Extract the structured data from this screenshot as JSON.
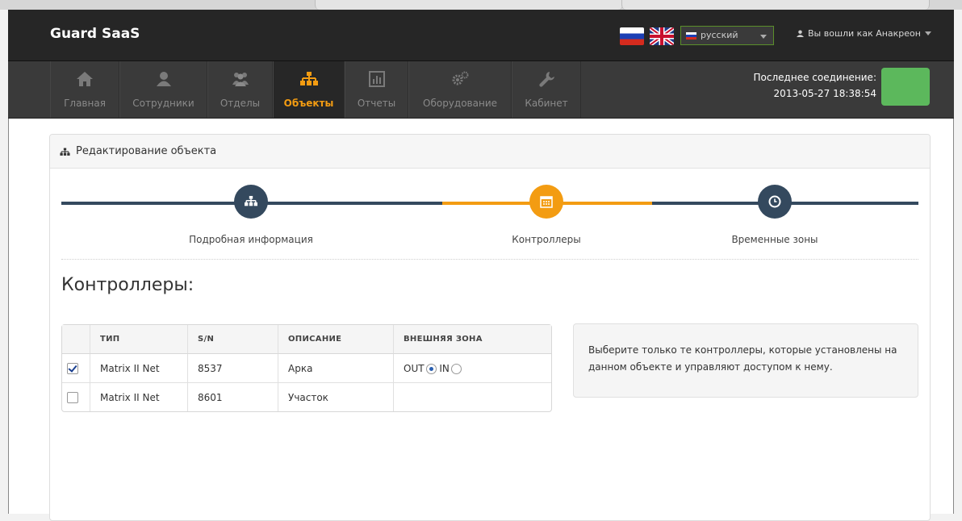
{
  "app": {
    "brand": "Guard SaaS"
  },
  "header": {
    "language": {
      "selected": "русский"
    },
    "user_label": "Вы вошли как Анакреон"
  },
  "menu": {
    "items": [
      {
        "label": "Главная",
        "icon": "home-icon",
        "active": false
      },
      {
        "label": "Сотрудники",
        "icon": "user-icon",
        "active": false
      },
      {
        "label": "Отделы",
        "icon": "group-icon",
        "active": false
      },
      {
        "label": "Объекты",
        "icon": "sitemap-icon",
        "active": true
      },
      {
        "label": "Отчеты",
        "icon": "chart-icon",
        "active": false
      },
      {
        "label": "Оборудование",
        "icon": "cogs-icon",
        "active": false
      },
      {
        "label": "Кабинет",
        "icon": "wrench-icon",
        "active": false
      }
    ],
    "status": {
      "label": "Последнее соединение:",
      "timestamp": "2013-05-27 18:38:54",
      "indicator_color": "#5cb85c"
    }
  },
  "panel": {
    "title": "Редактирование объекта",
    "wizard": {
      "steps": [
        {
          "label": "Подробная информация",
          "icon": "sitemap-icon",
          "state": "done"
        },
        {
          "label": "Контроллеры",
          "icon": "calendar-icon",
          "state": "current"
        },
        {
          "label": "Временные зоны",
          "icon": "clock-icon",
          "state": "pending"
        }
      ],
      "accent_color": "#f39c12",
      "dark_color": "#34495e"
    },
    "section_title": "Контроллеры:",
    "table": {
      "headers": [
        "ТИП",
        "S/N",
        "ОПИСАНИЕ",
        "ВНЕШНЯЯ ЗОНА"
      ],
      "rows": [
        {
          "checked": true,
          "type": "Matrix II Net",
          "sn": "8537",
          "description": "Арка",
          "zone_out": "OUT",
          "zone_in": "IN",
          "zone_selected": "OUT"
        },
        {
          "checked": false,
          "type": "Matrix II Net",
          "sn": "8601",
          "description": "Участок"
        }
      ]
    },
    "info_text": "Выберите только те контроллеры, которые установлены на данном объекте и управляют доступом к нему."
  }
}
